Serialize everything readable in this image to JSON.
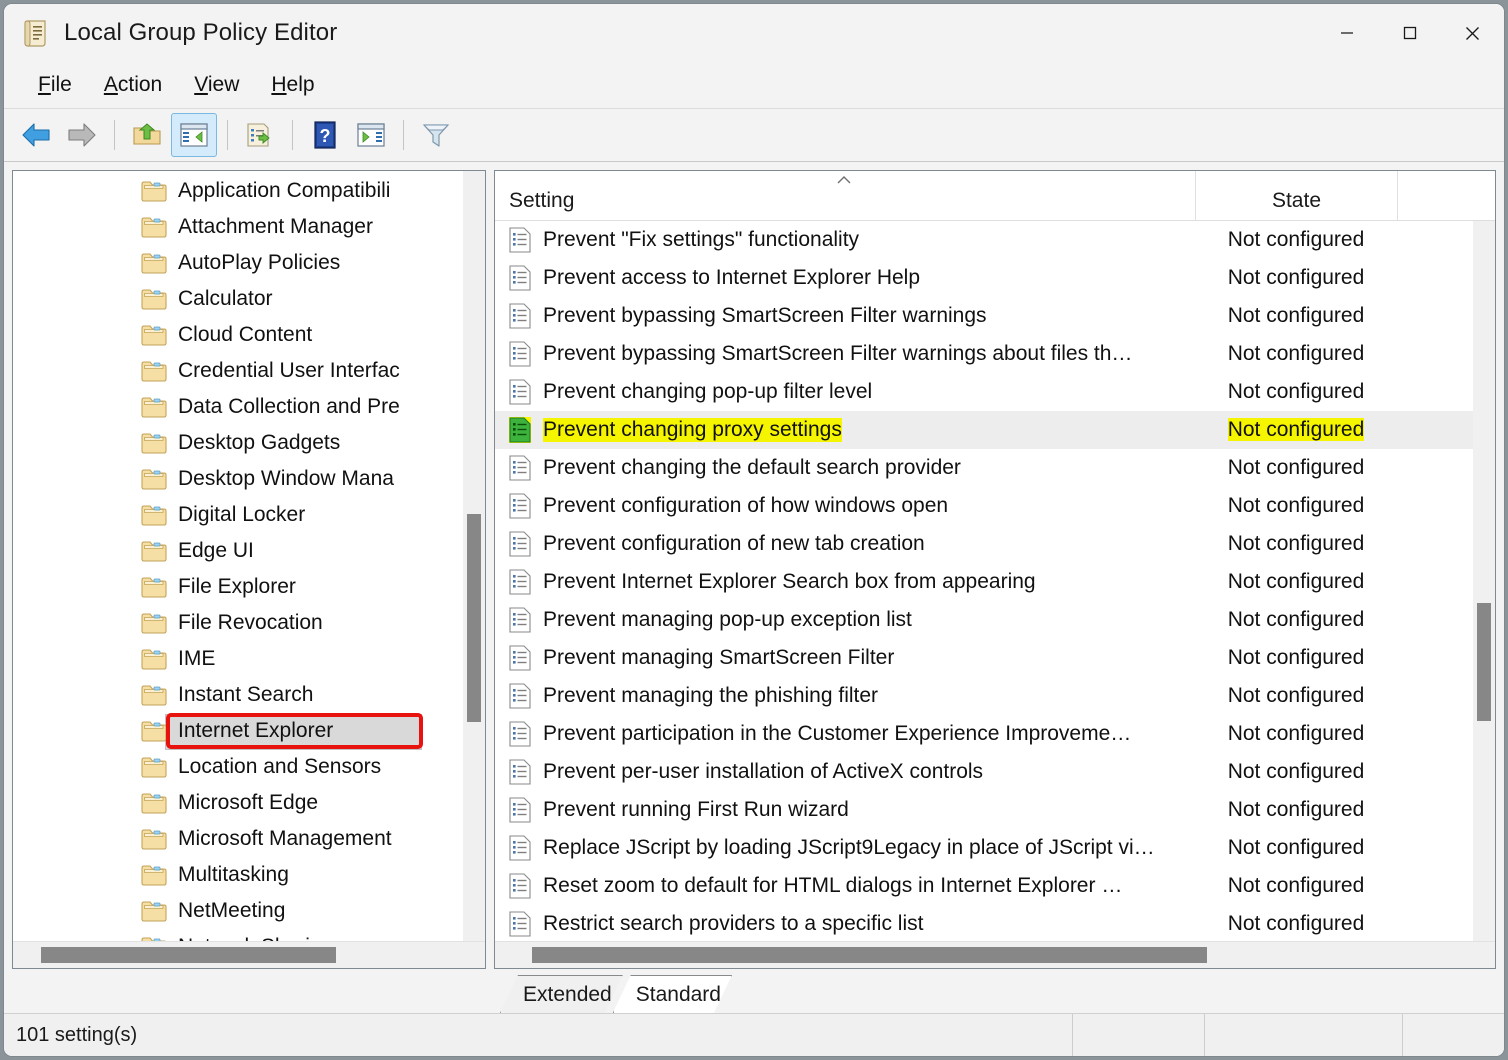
{
  "window": {
    "title": "Local Group Policy Editor",
    "icon": "group-policy-scroll-icon",
    "minimize_label": "—",
    "maximize_label": "□",
    "close_label": "✕"
  },
  "menubar": {
    "items": [
      {
        "label": "File",
        "accel": "F"
      },
      {
        "label": "Action",
        "accel": "A"
      },
      {
        "label": "View",
        "accel": "V"
      },
      {
        "label": "Help",
        "accel": "H"
      }
    ]
  },
  "toolbar": {
    "buttons": [
      {
        "name": "back-icon",
        "checked": false
      },
      {
        "name": "forward-icon",
        "checked": false
      },
      {
        "name": "up-one-level-icon",
        "checked": false
      },
      {
        "name": "show-hide-tree-icon",
        "checked": true
      },
      {
        "name": "export-list-icon",
        "checked": false
      },
      {
        "name": "help-icon",
        "checked": false
      },
      {
        "name": "show-action-pane-icon",
        "checked": false
      },
      {
        "name": "filter-icon",
        "checked": false
      }
    ]
  },
  "tree": {
    "items": [
      {
        "label": "Application Compatibili",
        "expandable": false,
        "selected": false
      },
      {
        "label": "Attachment Manager",
        "expandable": false,
        "selected": false
      },
      {
        "label": "AutoPlay Policies",
        "expandable": false,
        "selected": false
      },
      {
        "label": "Calculator",
        "expandable": false,
        "selected": false
      },
      {
        "label": "Cloud Content",
        "expandable": false,
        "selected": false
      },
      {
        "label": "Credential User Interfac",
        "expandable": false,
        "selected": false
      },
      {
        "label": "Data Collection and Pre",
        "expandable": false,
        "selected": false
      },
      {
        "label": "Desktop Gadgets",
        "expandable": false,
        "selected": false
      },
      {
        "label": "Desktop Window Mana",
        "expandable": true,
        "selected": false
      },
      {
        "label": "Digital Locker",
        "expandable": false,
        "selected": false
      },
      {
        "label": "Edge UI",
        "expandable": false,
        "selected": false
      },
      {
        "label": "File Explorer",
        "expandable": true,
        "selected": false
      },
      {
        "label": "File Revocation",
        "expandable": false,
        "selected": false
      },
      {
        "label": "IME",
        "expandable": false,
        "selected": false
      },
      {
        "label": "Instant Search",
        "expandable": false,
        "selected": false
      },
      {
        "label": "Internet Explorer",
        "expandable": true,
        "selected": true
      },
      {
        "label": "Location and Sensors",
        "expandable": false,
        "selected": false
      },
      {
        "label": "Microsoft Edge",
        "expandable": false,
        "selected": false
      },
      {
        "label": "Microsoft Management",
        "expandable": true,
        "selected": false
      },
      {
        "label": "Multitasking",
        "expandable": false,
        "selected": false
      },
      {
        "label": "NetMeeting",
        "expandable": true,
        "selected": false
      },
      {
        "label": "Network Sharing",
        "expandable": false,
        "selected": false
      }
    ],
    "highlight_color": "#e8130f",
    "selected_label": "Internet Explorer"
  },
  "list": {
    "columns": [
      {
        "key": "setting",
        "label": "Setting",
        "sort": "ascending"
      },
      {
        "key": "state",
        "label": "State",
        "sort": "none"
      }
    ],
    "rows": [
      {
        "setting": "Prevent \"Fix settings\" functionality",
        "state": "Not configured",
        "highlighted": false
      },
      {
        "setting": "Prevent access to Internet Explorer Help",
        "state": "Not configured",
        "highlighted": false
      },
      {
        "setting": "Prevent bypassing SmartScreen Filter warnings",
        "state": "Not configured",
        "highlighted": false
      },
      {
        "setting": "Prevent bypassing SmartScreen Filter warnings about files th…",
        "state": "Not configured",
        "highlighted": false
      },
      {
        "setting": "Prevent changing pop-up filter level",
        "state": "Not configured",
        "highlighted": false
      },
      {
        "setting": "Prevent changing proxy settings",
        "state": "Not configured",
        "highlighted": true
      },
      {
        "setting": "Prevent changing the default search provider",
        "state": "Not configured",
        "highlighted": false
      },
      {
        "setting": "Prevent configuration of how windows open",
        "state": "Not configured",
        "highlighted": false
      },
      {
        "setting": "Prevent configuration of new tab creation",
        "state": "Not configured",
        "highlighted": false
      },
      {
        "setting": "Prevent Internet Explorer Search box from appearing",
        "state": "Not configured",
        "highlighted": false
      },
      {
        "setting": "Prevent managing pop-up exception list",
        "state": "Not configured",
        "highlighted": false
      },
      {
        "setting": "Prevent managing SmartScreen Filter",
        "state": "Not configured",
        "highlighted": false
      },
      {
        "setting": "Prevent managing the phishing filter",
        "state": "Not configured",
        "highlighted": false
      },
      {
        "setting": "Prevent participation in the Customer Experience Improveme…",
        "state": "Not configured",
        "highlighted": false
      },
      {
        "setting": "Prevent per-user installation of ActiveX controls",
        "state": "Not configured",
        "highlighted": false
      },
      {
        "setting": "Prevent running First Run wizard",
        "state": "Not configured",
        "highlighted": false
      },
      {
        "setting": "Replace JScript by loading JScript9Legacy in place of JScript vi…",
        "state": "Not configured",
        "highlighted": false
      },
      {
        "setting": "Reset zoom to default for HTML dialogs in Internet Explorer …",
        "state": "Not configured",
        "highlighted": false
      },
      {
        "setting": "Restrict search providers to a specific list",
        "state": "Not configured",
        "highlighted": false
      }
    ],
    "highlight_color": "#f5f500"
  },
  "tabs": [
    {
      "label": "Extended",
      "active": false
    },
    {
      "label": "Standard",
      "active": true
    }
  ],
  "statusbar": {
    "text": "101 setting(s)",
    "cell2": "",
    "cell3": "",
    "cell4": ""
  }
}
